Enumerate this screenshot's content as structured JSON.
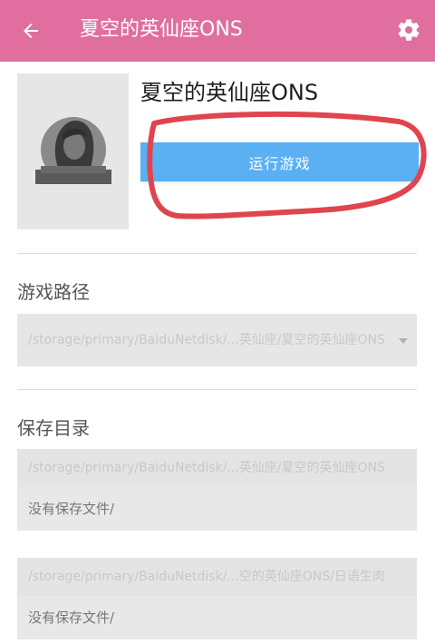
{
  "colors": {
    "appbar": "#e06fa0",
    "run_button": "#5ab0f2",
    "annotation": "#e0454e"
  },
  "header": {
    "back_icon": "arrow-left-icon",
    "title": "夏空的英仙座ONS",
    "settings_icon": "gear-icon"
  },
  "game": {
    "title": "夏空的英仙座ONS",
    "run_label": "运行游戏"
  },
  "game_path": {
    "label": "游戏路径",
    "value": "/storage/primary/BaiduNetdisk/...英仙座/夏空的英仙座ONS"
  },
  "save_dir": {
    "label": "保存目录",
    "entries": [
      {
        "path": "/storage/primary/BaiduNetdisk/...英仙座/夏空的英仙座ONS",
        "status": "没有保存文件/"
      },
      {
        "path": "/storage/primary/BaiduNetdisk/...空的英仙座ONS/日语生肉",
        "status": "没有保存文件/"
      }
    ]
  }
}
